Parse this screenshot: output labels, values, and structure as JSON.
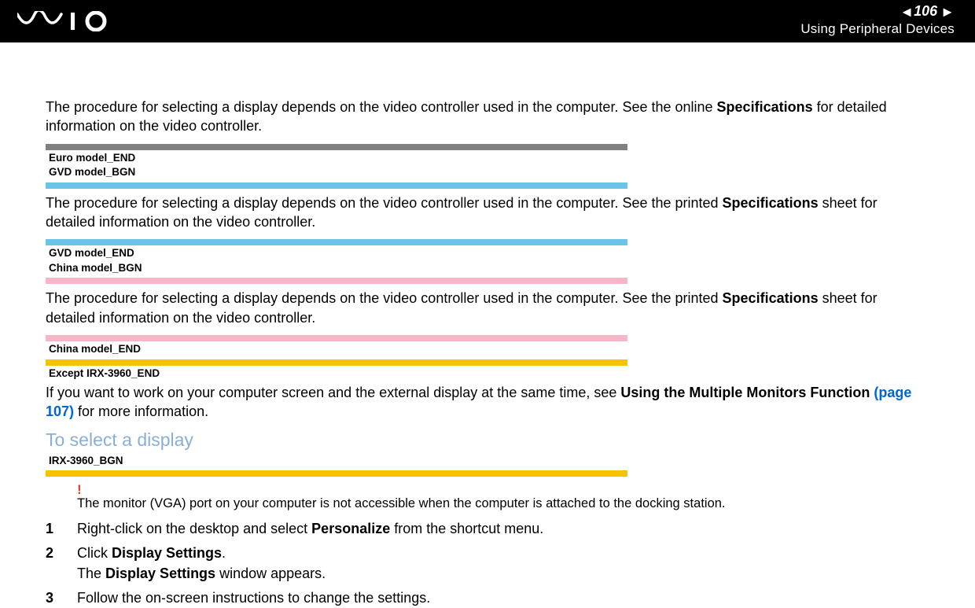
{
  "header": {
    "page_number": "106",
    "section": "Using Peripheral Devices"
  },
  "intro": {
    "pre": "The procedure for selecting a display depends on the video controller used in the computer. See the online ",
    "bold": "Specifications",
    "post": " for detailed information on the video controller."
  },
  "tags": {
    "euro_end": "Euro model_END",
    "gvd_bgn": "GVD model_BGN",
    "gvd_end": "GVD model_END",
    "china_bgn": "China model_BGN",
    "china_end": "China model_END",
    "except_irx_end": "Except IRX-3960_END",
    "irx_bgn": "IRX-3960_BGN"
  },
  "gvd_para": {
    "pre": "The procedure for selecting a display depends on the video controller used in the computer. See the printed ",
    "bold": "Specifications",
    "post": " sheet for detailed information on the video controller."
  },
  "china_para": {
    "pre": "The procedure for selecting a display depends on the video controller used in the computer. See the printed ",
    "bold": "Specifications",
    "post": " sheet for detailed information on the video controller."
  },
  "multimon": {
    "pre": "If you want to work on your computer screen and the external display at the same time, see ",
    "bold": "Using the Multiple Monitors Function",
    "link": " (page 107)",
    "post": " for more information."
  },
  "heading": "To select a display",
  "note": {
    "mark": "!",
    "text": "The monitor (VGA) port on your computer is not accessible when the computer is attached to the docking station."
  },
  "steps": [
    {
      "num": "1",
      "pre": "Right-click on the desktop and select ",
      "bold": "Personalize",
      "post": " from the shortcut menu."
    },
    {
      "num": "2",
      "pre": "Click ",
      "bold": "Display Settings",
      "post": ".",
      "line2pre": "The ",
      "line2bold": "Display Settings",
      "line2post": " window appears."
    },
    {
      "num": "3",
      "pre": "Follow the on-screen instructions to change the settings.",
      "bold": "",
      "post": ""
    }
  ]
}
